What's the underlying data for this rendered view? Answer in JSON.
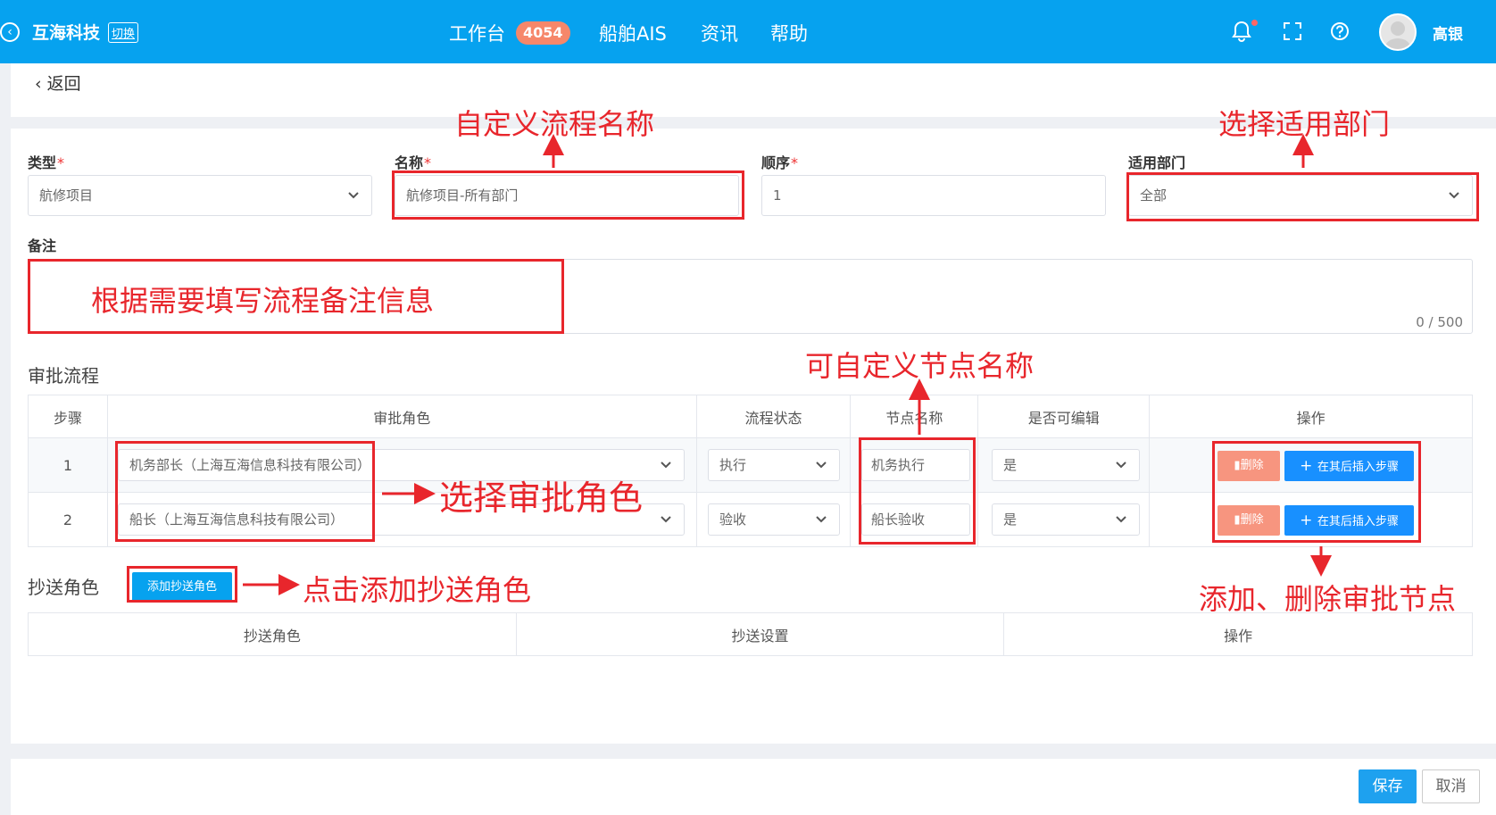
{
  "header": {
    "brand": "互海科技",
    "switch_label": "切换",
    "nav": [
      "工作台",
      "船舶AIS",
      "资讯",
      "帮助"
    ],
    "workbench_badge": "4054",
    "username": "高银",
    "icons": [
      "back-circle-icon",
      "bell-icon",
      "fullscreen-icon",
      "help-icon"
    ]
  },
  "back_label": "返回",
  "form": {
    "type_label": "类型",
    "type_value": "航修项目",
    "name_label": "名称",
    "name_value": "航修项目-所有部门",
    "order_label": "顺序",
    "order_value": "1",
    "dept_label": "适用部门",
    "dept_value": "全部",
    "remark_label": "备注",
    "remark_counter": "0 / 500",
    "required_mark": "*"
  },
  "approval": {
    "section_title": "审批流程",
    "headers": [
      "步骤",
      "审批角色",
      "流程状态",
      "节点名称",
      "是否可编辑",
      "操作"
    ],
    "rows": [
      {
        "step": "1",
        "role": "机务部长（上海互海信息科技有限公司）",
        "status": "执行",
        "node": "机务执行",
        "editable": "是"
      },
      {
        "step": "2",
        "role": "船长（上海互海信息科技有限公司）",
        "status": "验收",
        "node": "船长验收",
        "editable": "是"
      }
    ],
    "delete_label": "删除",
    "insert_label": "在其后插入步骤"
  },
  "cc": {
    "section_title": "抄送角色",
    "add_button": "添加抄送角色",
    "headers": [
      "抄送角色",
      "抄送设置",
      "操作"
    ]
  },
  "footer": {
    "save": "保存",
    "cancel": "取消"
  },
  "annotations": {
    "name_hint": "自定义流程名称",
    "dept_hint": "选择适用部门",
    "remark_hint": "根据需要填写流程备注信息",
    "node_hint": "可自定义节点名称",
    "role_hint": "选择审批角色",
    "cc_hint": "点击添加抄送角色",
    "ops_hint": "添加、删除审批节点"
  },
  "colors": {
    "primary": "#06a2ef",
    "annotation_red": "#e8262c",
    "delete_btn": "#f7957f",
    "insert_btn": "#1890ff"
  }
}
